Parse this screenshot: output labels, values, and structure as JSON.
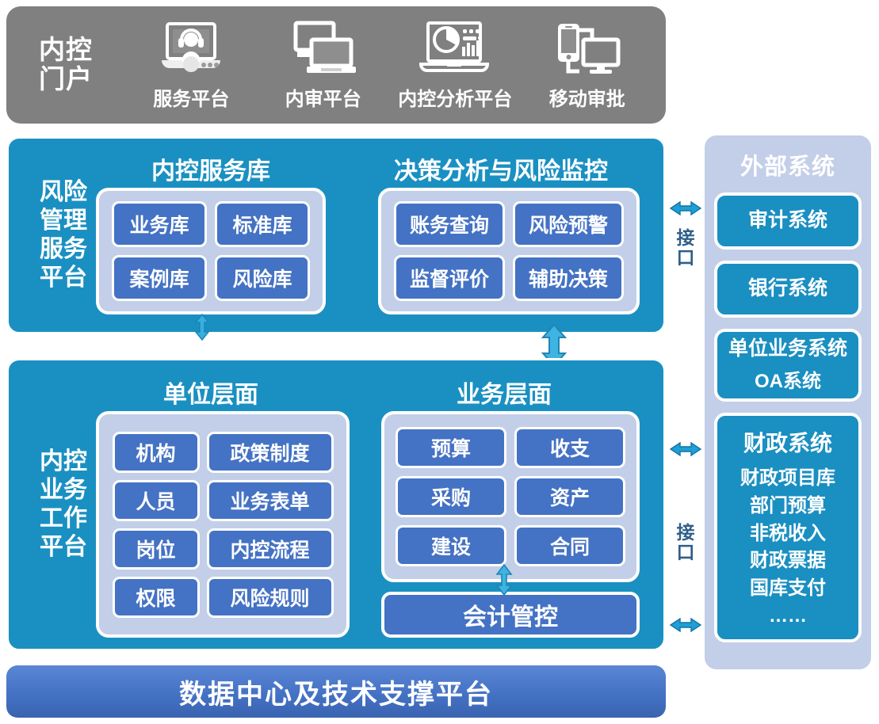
{
  "portal": {
    "title_lines": [
      "内控",
      "门户"
    ],
    "items": [
      {
        "label": "服务平台",
        "icon": "laptop-support-agent-icon"
      },
      {
        "label": "内审平台",
        "icon": "monitor-laptop-icon"
      },
      {
        "label": "内控分析平台",
        "icon": "laptop-analytics-dashboard-icon"
      },
      {
        "label": "移动审批",
        "icon": "phone-monitor-icon"
      }
    ]
  },
  "risk_platform": {
    "side_title_lines": [
      "风险",
      "管理",
      "服务",
      "平台"
    ],
    "groups": [
      {
        "heading": "内控服务库",
        "cells": [
          "业务库",
          "标准库",
          "案例库",
          "风险库"
        ]
      },
      {
        "heading": "决策分析与风险监控",
        "cells": [
          "账务查询",
          "风险预警",
          "监督评价",
          "辅助决策"
        ]
      }
    ]
  },
  "business_platform": {
    "side_title_lines": [
      "内控",
      "业务",
      "工作",
      "平台"
    ],
    "groups": [
      {
        "heading": "单位层面",
        "cells": [
          "机构",
          "政策制度",
          "人员",
          "业务表单",
          "岗位",
          "内控流程",
          "权限",
          "风险规则"
        ]
      },
      {
        "heading": "业务层面",
        "cells": [
          "预算",
          "收支",
          "采购",
          "资产",
          "建设",
          "合同"
        ]
      }
    ],
    "standalone_cell": "会计管控"
  },
  "external_systems": {
    "title": "外部系统",
    "boxes": [
      {
        "name": "审计系统"
      },
      {
        "name": "银行系统"
      },
      {
        "name": "单位业务系统",
        "sub": "OA系统"
      },
      {
        "name": "财政系统",
        "items": [
          "财政项目库",
          "部门预算",
          "非税收入",
          "财政票据",
          "国库支付",
          "……"
        ]
      }
    ]
  },
  "bottom_bar": {
    "label": "数据中心及技术支撑平台"
  },
  "connectors": {
    "interface_label_top": "接口",
    "interface_label_bottom": "接口",
    "interface_chars": [
      "接",
      "口"
    ]
  },
  "colors": {
    "portal_grey": "#808080",
    "panel_teal": "#1a90c2",
    "group_lavender": "#c3cfe8",
    "cell_blue": "#4472c4",
    "external_box_teal": "#1a8fc1",
    "bottom_blue": "#4472c4",
    "arrow_blue": "#29a8dd",
    "white": "#ffffff"
  }
}
